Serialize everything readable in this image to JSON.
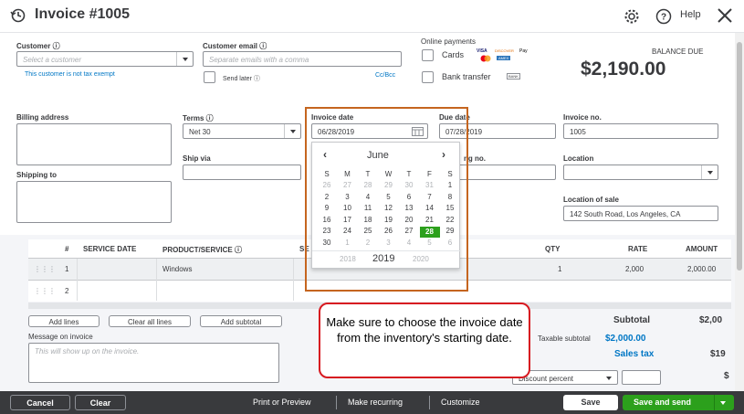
{
  "header": {
    "title": "Invoice #1005",
    "help_label": "Help"
  },
  "customer": {
    "label": "Customer",
    "placeholder": "Select a customer",
    "tax_note": "This customer is not tax exempt",
    "email_label": "Customer email",
    "email_placeholder": "Separate emails with a comma",
    "send_later": "Send later",
    "cc_bcc": "Cc/Bcc"
  },
  "online_payments": {
    "label": "Online payments",
    "cards": "Cards",
    "bank_transfer": "Bank transfer",
    "card_brands": [
      "VISA",
      "DISCOVER",
      "Pay",
      "MC",
      "AMEX"
    ],
    "bank_badge": "BANK"
  },
  "balance": {
    "label": "BALANCE DUE",
    "amount": "$2,190.00"
  },
  "fields": {
    "billing_address": "Billing address",
    "shipping_to": "Shipping to",
    "terms_label": "Terms",
    "terms_value": "Net 30",
    "ship_via": "Ship via",
    "invoice_date_label": "Invoice date",
    "invoice_date_value": "06/28/2019",
    "due_date_label": "Due date",
    "due_date_value": "07/28/2019",
    "invoice_no_label": "Invoice no.",
    "invoice_no_value": "1005",
    "tracking_label": "ng no.",
    "location_label": "Location",
    "location_of_sale_label": "Location of sale",
    "location_of_sale_value": "142 South Road, Los Angeles, CA"
  },
  "calendar": {
    "month": "June",
    "year": "2019",
    "prev_year": "2018",
    "next_year": "2020",
    "weekdays": [
      "S",
      "M",
      "T",
      "W",
      "T",
      "F",
      "S"
    ],
    "weeks": [
      [
        "26",
        "27",
        "28",
        "29",
        "30",
        "31",
        "1"
      ],
      [
        "2",
        "3",
        "4",
        "5",
        "6",
        "7",
        "8"
      ],
      [
        "9",
        "10",
        "11",
        "12",
        "13",
        "14",
        "15"
      ],
      [
        "16",
        "17",
        "18",
        "19",
        "20",
        "21",
        "22"
      ],
      [
        "23",
        "24",
        "25",
        "26",
        "27",
        "28",
        "29"
      ],
      [
        "30",
        "1",
        "2",
        "3",
        "4",
        "5",
        "6"
      ]
    ],
    "selected_day": "28"
  },
  "table": {
    "headers": [
      "#",
      "SERVICE DATE",
      "PRODUCT/SERVICE",
      "SE",
      "QTY",
      "RATE",
      "AMOUNT"
    ],
    "rows": [
      {
        "num": "1",
        "product": "Windows",
        "qty": "1",
        "rate": "2,000",
        "amount": "2,000.00"
      },
      {
        "num": "2",
        "product": "",
        "qty": "",
        "rate": "",
        "amount": ""
      }
    ]
  },
  "actions": {
    "add_lines": "Add lines",
    "clear_all_lines": "Clear all lines",
    "add_subtotal": "Add subtotal"
  },
  "message": {
    "label": "Message on invoice",
    "placeholder": "This will show up on the invoice."
  },
  "totals": {
    "subtotal_label": "Subtotal",
    "subtotal_value": "$2,00",
    "taxable_label": "Taxable subtotal",
    "taxable_value": "$2,000.00",
    "sales_tax_label": "Sales tax",
    "sales_tax_value": "$19",
    "discount_label": "Discount percent",
    "discount_trail": "$"
  },
  "note": {
    "text": "Make sure to choose the invoice date from the inventory's starting date."
  },
  "footer": {
    "cancel": "Cancel",
    "clear": "Clear",
    "print": "Print or Preview",
    "recurring": "Make recurring",
    "customize": "Customize",
    "save": "Save",
    "save_send": "Save and send"
  },
  "colors": {
    "accent_green": "#2ca01c",
    "link_blue": "#0077c5",
    "footer_bg": "#393a3d",
    "note_border": "#d71920",
    "highlight_border": "#c5651f"
  }
}
